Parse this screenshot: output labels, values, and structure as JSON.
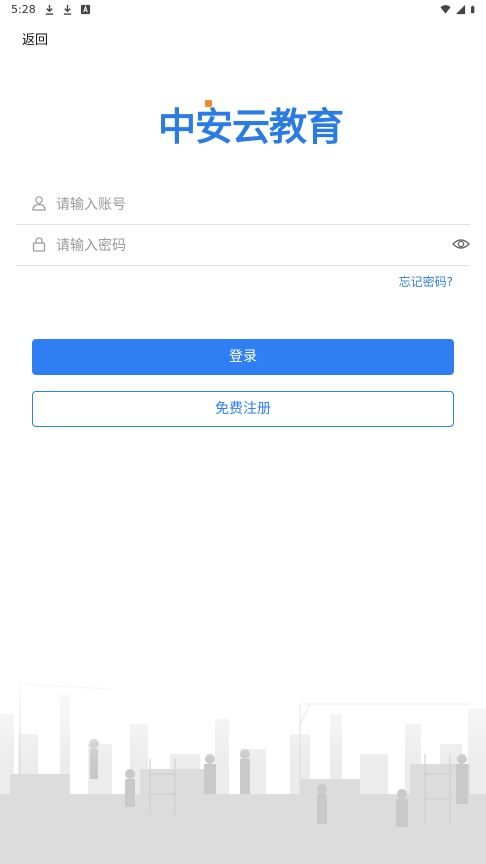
{
  "status_bar": {
    "time": "5:28",
    "left_icons": [
      "download-icon",
      "download-icon",
      "notification-a-icon"
    ],
    "right_icons": [
      "wifi-icon",
      "signal-icon",
      "battery-icon"
    ]
  },
  "header": {
    "back_label": "返回"
  },
  "logo": {
    "text": "中安云教育",
    "brand_color": "#2a7be4",
    "accent_color": "#f08a2a"
  },
  "form": {
    "account": {
      "placeholder": "请输入账号",
      "value": "",
      "icon": "user-icon"
    },
    "password": {
      "placeholder": "请输入密码",
      "value": "",
      "icon": "lock-icon",
      "toggle_icon": "eye-icon"
    },
    "forgot_label": "忘记密码?"
  },
  "buttons": {
    "login_label": "登录",
    "register_label": "免费注册",
    "primary_color": "#2f7ef2"
  },
  "decoration": {
    "illustration": "construction-workers-skyline"
  }
}
